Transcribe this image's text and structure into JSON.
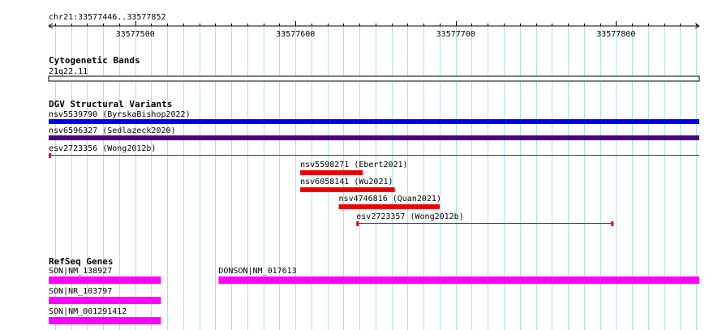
{
  "ruler": {
    "region": "chr21:33577446..33577852",
    "ticks": [
      {
        "label": "33577500",
        "pos": 33577500
      },
      {
        "label": "33577600",
        "pos": 33577600
      },
      {
        "label": "33577700",
        "pos": 33577700
      },
      {
        "label": "33577800",
        "pos": 33577800
      }
    ],
    "view_start": 33577446,
    "view_end": 33577852
  },
  "tracks": {
    "cytoband": {
      "title": "Cytogenetic Bands",
      "label": "21q22.11"
    },
    "dgv": {
      "title": "DGV Structural Variants",
      "features": [
        {
          "id": "nsv5539790",
          "label": "nsv5539790 (ByrskaBishop2022)",
          "start": 33577446,
          "end": 33577852,
          "color": "#0000ee",
          "style": "bar"
        },
        {
          "id": "nsv6596327",
          "label": "nsv6596327 (Sedlazeck2020)",
          "start": 33577446,
          "end": 33577852,
          "color": "#4b0082",
          "style": "bar"
        },
        {
          "id": "esv2723356",
          "label": "esv2723356 (Wong2012b)",
          "start": 33577446,
          "end": 33577852,
          "color": "#ee0000",
          "style": "line"
        },
        {
          "id": "nsv5598271",
          "label": "nsv5598271 (Ebert2021)",
          "start": 33577603,
          "end": 33577642,
          "color": "#ee0000",
          "style": "bar"
        },
        {
          "id": "nsv6058141",
          "label": "nsv6058141 (Wu2021)",
          "start": 33577603,
          "end": 33577662,
          "color": "#ee0000",
          "style": "bar"
        },
        {
          "id": "nsv4746816",
          "label": "nsv4746816 (Quan2021)",
          "start": 33577627,
          "end": 33577690,
          "color": "#ee0000",
          "style": "bar"
        },
        {
          "id": "esv2723357",
          "label": "esv2723357 (Wong2012b)",
          "start": 33577638,
          "end": 33577798,
          "color": "#ee0000",
          "style": "line"
        }
      ]
    },
    "refseq": {
      "title": "RefSeq Genes",
      "color": "#ff00ff",
      "genes": [
        {
          "label": "SON|NM_138927",
          "start": 33577446,
          "end": 33577516
        },
        {
          "label": "DONSON|NM_017613",
          "start": 33577552,
          "end": 33577852
        },
        {
          "label": "SON|NR_103797",
          "start": 33577446,
          "end": 33577516
        },
        {
          "label": "SON|NM_001291412",
          "start": 33577446,
          "end": 33577516
        }
      ]
    }
  },
  "colors": {
    "grid": "#b0e0f0",
    "axis": "#000000",
    "dgv_gain_loss": "#ee0000",
    "refseq": "#ff00ff"
  }
}
